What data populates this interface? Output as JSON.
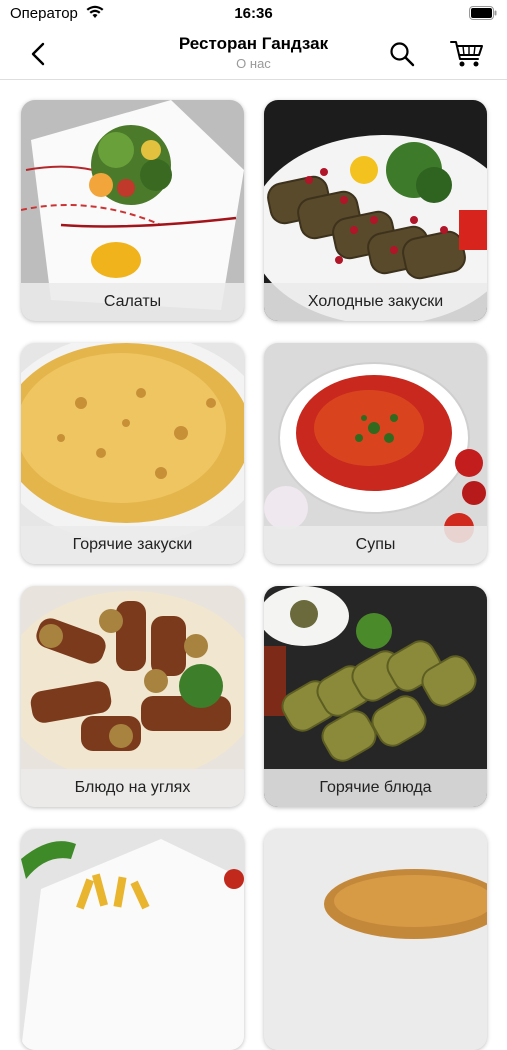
{
  "status_bar": {
    "carrier": "Оператор",
    "time": "16:36"
  },
  "nav": {
    "title": "Ресторан Гандзак",
    "subtitle": "О нас",
    "back_icon": "chevron-left-icon",
    "search_icon": "search-icon",
    "cart_icon": "cart-icon"
  },
  "categories": [
    {
      "label": "Салаты"
    },
    {
      "label": "Холодные закуски"
    },
    {
      "label": "Горячие закуски"
    },
    {
      "label": "Супы"
    },
    {
      "label": "Блюдо на углях"
    },
    {
      "label": "Горячие блюда"
    },
    {
      "label": ""
    },
    {
      "label": ""
    }
  ]
}
